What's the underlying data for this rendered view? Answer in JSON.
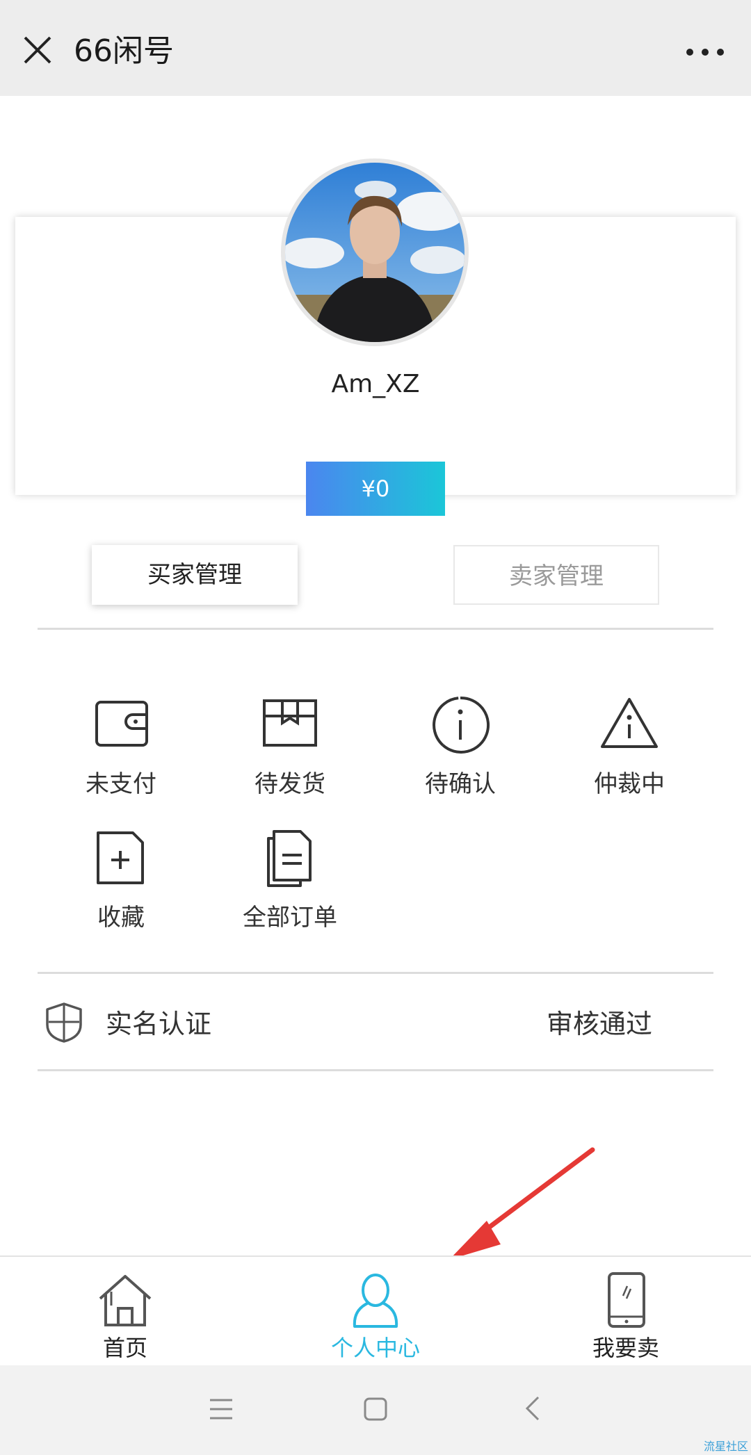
{
  "app": {
    "title": "66闲号"
  },
  "profile": {
    "username": "Am_XZ",
    "balance": "¥0"
  },
  "tabs": {
    "buyer": "买家管理",
    "seller": "卖家管理"
  },
  "orders": [
    {
      "label": "未支付",
      "icon": "wallet-icon"
    },
    {
      "label": "待发货",
      "icon": "box-icon"
    },
    {
      "label": "待确认",
      "icon": "info-circle-icon"
    },
    {
      "label": "仲裁中",
      "icon": "warning-triangle-icon"
    },
    {
      "label": "收藏",
      "icon": "folder-plus-icon"
    },
    {
      "label": "全部订单",
      "icon": "documents-icon"
    }
  ],
  "verification": {
    "label": "实名认证",
    "status": "审核通过",
    "icon": "shield-icon"
  },
  "bottom_nav": [
    {
      "label": "首页",
      "icon": "home-icon",
      "active": false
    },
    {
      "label": "个人中心",
      "icon": "person-icon",
      "active": true
    },
    {
      "label": "我要卖",
      "icon": "phone-icon",
      "active": false
    }
  ],
  "system_nav": {
    "menu_icon": "menu-icon",
    "home_icon": "square-icon",
    "back_icon": "back-icon"
  },
  "watermark": "流星社区",
  "colors": {
    "accent": "#2ab8e0",
    "balance_gradient_start": "#4b86ef",
    "balance_gradient_end": "#1bc6d8",
    "arrow": "#e53935"
  }
}
